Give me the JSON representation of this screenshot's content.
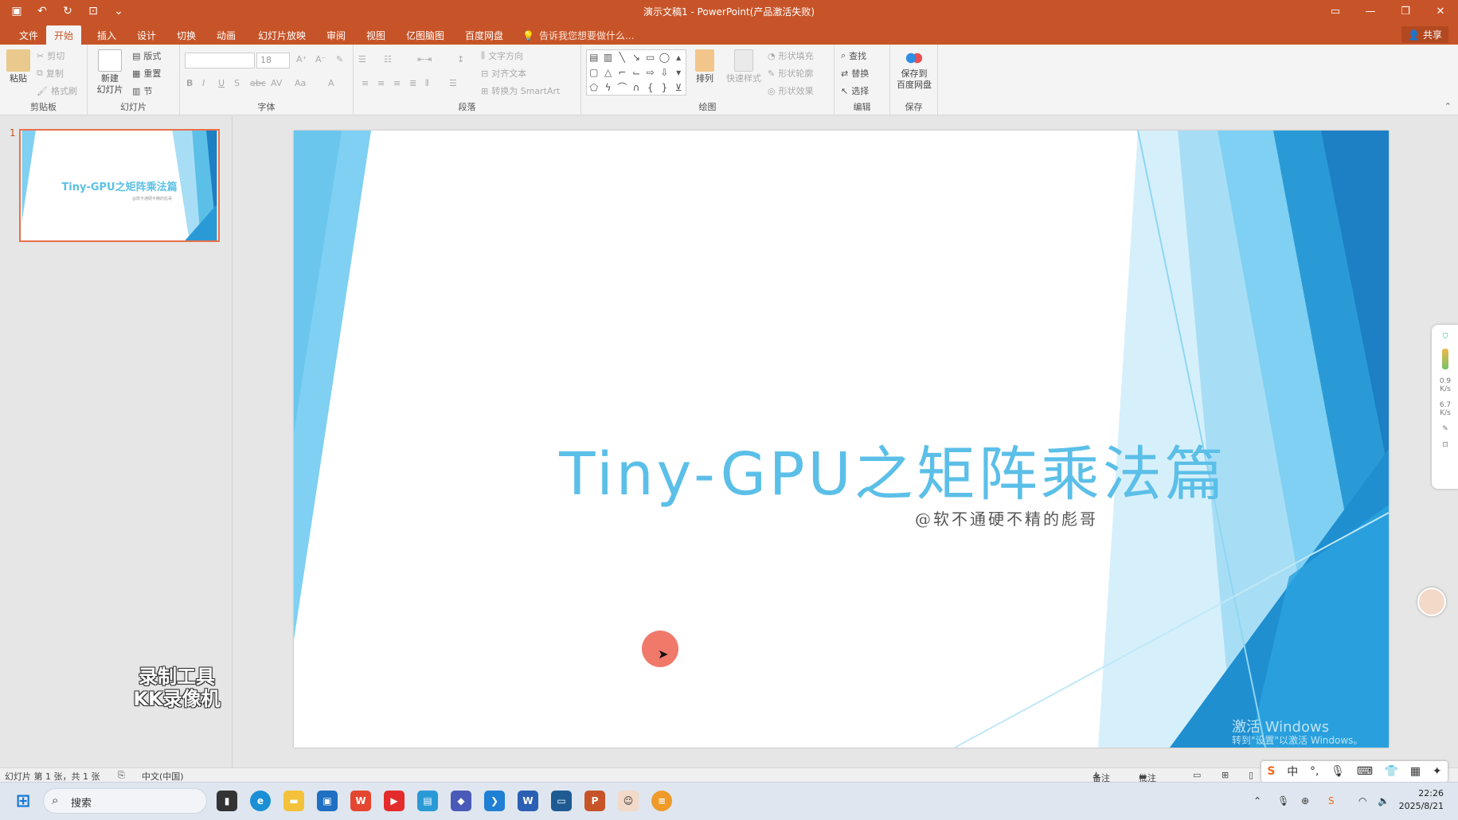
{
  "window": {
    "title": "演示文稿1 - PowerPoint(产品激活失败)"
  },
  "tabs": [
    "文件",
    "开始",
    "插入",
    "设计",
    "切换",
    "动画",
    "幻灯片放映",
    "审阅",
    "视图",
    "亿图脑图",
    "百度网盘"
  ],
  "active_tab_index": 1,
  "tell_me": "告诉我您想要做什么...",
  "share": "共享",
  "ribbon": {
    "clipboard": {
      "paste": "粘贴",
      "cut": "剪切",
      "copy": "复制",
      "format_painter": "格式刷",
      "label": "剪贴板"
    },
    "slides": {
      "new_slide_line1": "新建",
      "new_slide_line2": "幻灯片",
      "layout": "版式",
      "reset": "重置",
      "section": "节",
      "label": "幻灯片"
    },
    "font": {
      "size": "18",
      "label": "字体"
    },
    "paragraph": {
      "text_direction": "文字方向",
      "align_text": "对齐文本",
      "convert_smartart": "转换为 SmartArt",
      "label": "段落"
    },
    "drawing": {
      "arrange": "排列",
      "quick_styles": "快速样式",
      "shape_fill": "形状填充",
      "shape_outline": "形状轮廓",
      "shape_effects": "形状效果",
      "label": "绘图"
    },
    "editing": {
      "find": "查找",
      "replace": "替换",
      "select": "选择",
      "label": "编辑"
    },
    "save": {
      "line1": "保存到",
      "line2": "百度网盘",
      "label": "保存"
    }
  },
  "thumbnail": {
    "number": "1",
    "title": "Tiny-GPU之矩阵乘法篇",
    "subtitle": "@软不通硬不精的彪哥"
  },
  "slide": {
    "title": "Tiny-GPU之矩阵乘法篇",
    "subtitle": "@软不通硬不精的彪哥",
    "activate_line1": "激活 Windows",
    "activate_line2": "转到\"设置\"以激活 Windows。"
  },
  "recorder_watermark": {
    "line1": "录制工具",
    "line2": "KK录像机"
  },
  "floatbar": {
    "speed1": "0.9",
    "speed1_unit": "K/s",
    "speed2": "6.7",
    "speed2_unit": "K/s"
  },
  "statusbar": {
    "slide_count": "幻灯片 第 1 张，共 1 张",
    "language": "中文(中国)",
    "notes": "备注",
    "comments": "批注"
  },
  "taskbar": {
    "search_placeholder": "搜索",
    "time": "22:26",
    "date": "2025/8/21"
  },
  "ime": {
    "mode": "中"
  },
  "colors": {
    "accent": "#c75428",
    "slide_title": "#5bbfe8",
    "slide_blue_dark": "#1d7fc4",
    "slide_blue_light": "#7fd0f2"
  }
}
